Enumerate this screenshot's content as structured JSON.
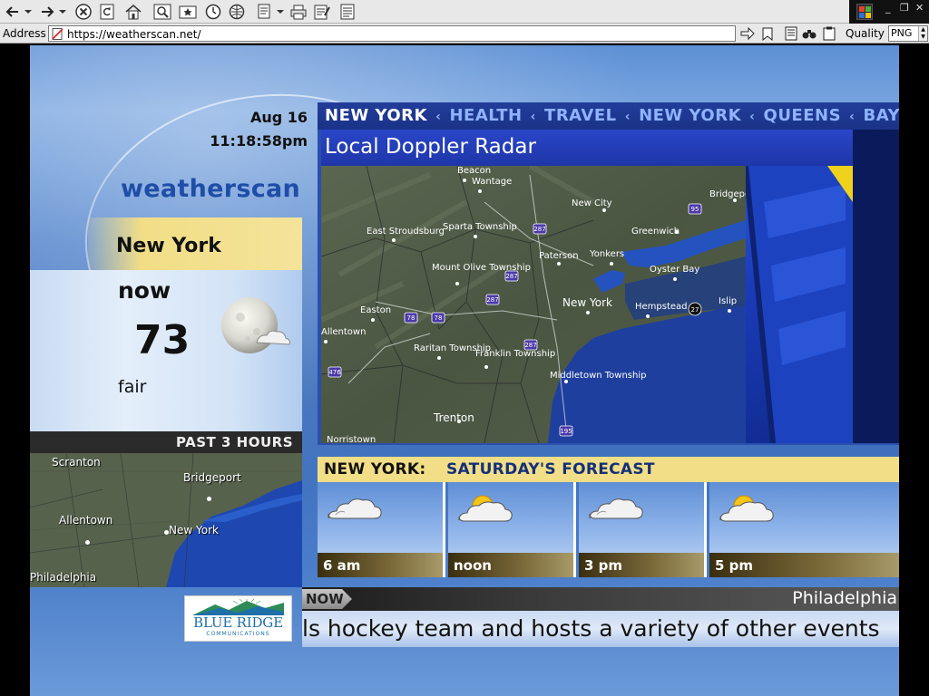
{
  "browser": {
    "address_label": "Address",
    "url": "https://weatherscan.net/",
    "quality_label": "Quality",
    "format": "PNG"
  },
  "ws": {
    "date": "Aug 16",
    "time": "11:18:58pm",
    "logo": "weatherscan",
    "city": "New York",
    "now_label": "now",
    "temp": "73",
    "condition": "fair",
    "past_label": "PAST 3 HOURS",
    "small_map_labels": [
      "Scranton",
      "Bridgeport",
      "Allentown",
      "New York",
      "Philadelphia"
    ],
    "ticker": [
      "NEW YORK",
      "HEALTH",
      "TRAVEL",
      "NEW YORK",
      "QUEENS",
      "BAYONNE"
    ],
    "radar_title": "Local Doppler Radar",
    "radar_labels": [
      "Beacon",
      "Wantage",
      "New City",
      "Bridgeport",
      "East Stroudsburg",
      "Sparta Township",
      "Greenwich",
      "Paterson",
      "Yonkers",
      "Mount Olive Township",
      "Oyster Bay",
      "New York",
      "Easton",
      "Hempstead",
      "Islip",
      "Raritan Township",
      "Franklin Township",
      "Middletown Township",
      "Trenton",
      "Allentown",
      "Norristown"
    ],
    "radar_routes": [
      "287",
      "95",
      "287",
      "287",
      "78",
      "78",
      "287",
      "95",
      "476",
      "195",
      "27"
    ],
    "forecast_city": "NEW YORK:",
    "forecast_title": "SATURDAY'S FORECAST",
    "forecast": [
      {
        "time": "6 am",
        "icon": "cloudy-icon"
      },
      {
        "time": "noon",
        "icon": "partly-cloudy-icon"
      },
      {
        "time": "3 pm",
        "icon": "cloudy-icon"
      },
      {
        "time": "5 pm",
        "icon": "partly-cloudy-icon"
      }
    ],
    "now_tag": "NOW",
    "now_city": "Philadelphia",
    "crawl": "ls hockey team and hosts a variety of other events",
    "sponsor_name": "BLUE RIDGE",
    "sponsor_sub": "COMMUNICATIONS"
  }
}
